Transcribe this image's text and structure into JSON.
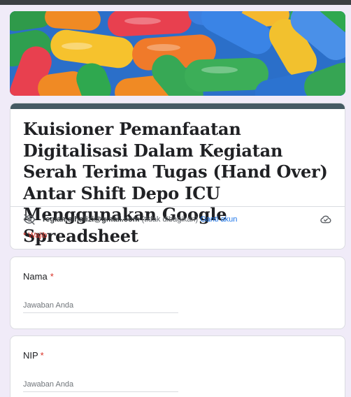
{
  "form": {
    "title": "Kuisioner Pemanfaatan Digitalisasi Dalam Kegiatan Serah Terima Tugas (Hand Over) Antar Shift Depo ICU Menggunakan Google Spreadsheet",
    "account_email": "regian.alhafizi@gmail.com",
    "account_shared": "(tidak dibagikan)",
    "switch_account": "Ganti akun",
    "required_note": "* Wajib"
  },
  "questions": [
    {
      "title": "Nama",
      "required_mark": "*",
      "placeholder": "Jawaban Anda"
    },
    {
      "title": "NIP",
      "required_mark": "*",
      "placeholder": "Jawaban Anda"
    }
  ],
  "icons": {
    "privacy": "eye-off-icon",
    "cloud": "cloud-check-icon"
  },
  "colors": {
    "background": "#f0ebf8",
    "title_accent": "#455a64",
    "link": "#1a73e8",
    "required": "#d93025"
  }
}
